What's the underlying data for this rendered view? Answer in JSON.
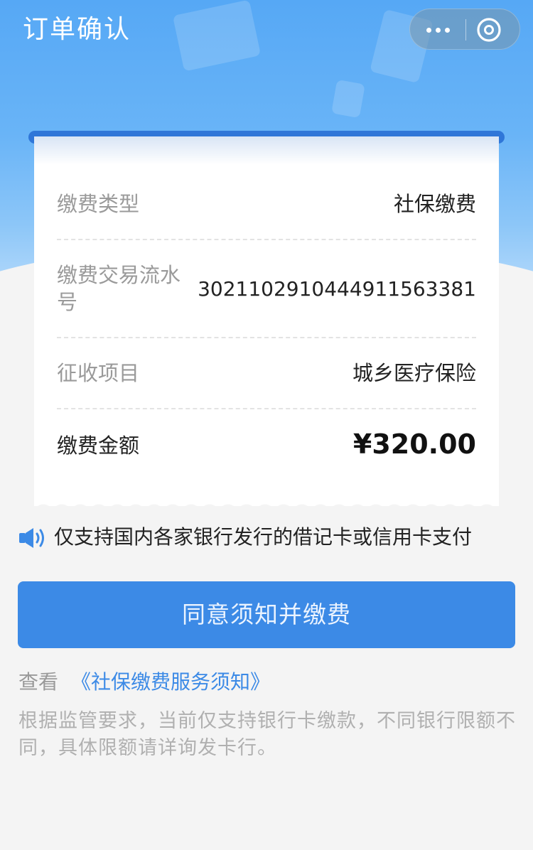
{
  "header": {
    "title": "订单确认",
    "more_icon": "more-dots-icon",
    "close_icon": "close-circle-icon"
  },
  "order": {
    "rows": [
      {
        "label": "缴费类型",
        "value": "社保缴费"
      },
      {
        "label": "缴费交易流水号",
        "value": "302110291044491156338​1"
      },
      {
        "label": "征收项目",
        "value": "城乡医疗保险"
      }
    ],
    "amount": {
      "label": "缴费金额",
      "value": "¥320.00"
    }
  },
  "notice": {
    "icon": "speaker-icon",
    "text": "仅支持国内各家银行发行的借记卡或信用卡支付"
  },
  "pay_button_label": "同意须知并缴费",
  "terms": {
    "prefix": "查看",
    "link": "《社保缴费服务须知》"
  },
  "tip": "根据监管要求，当前仅支持银行卡缴款，不同银行限额不同，具体限额请详询发卡行。",
  "colors": {
    "header_blue": "#56a8f5",
    "button_blue": "#3c8ae6",
    "link_blue": "#3c8ae6",
    "background": "#f4f4f4"
  }
}
